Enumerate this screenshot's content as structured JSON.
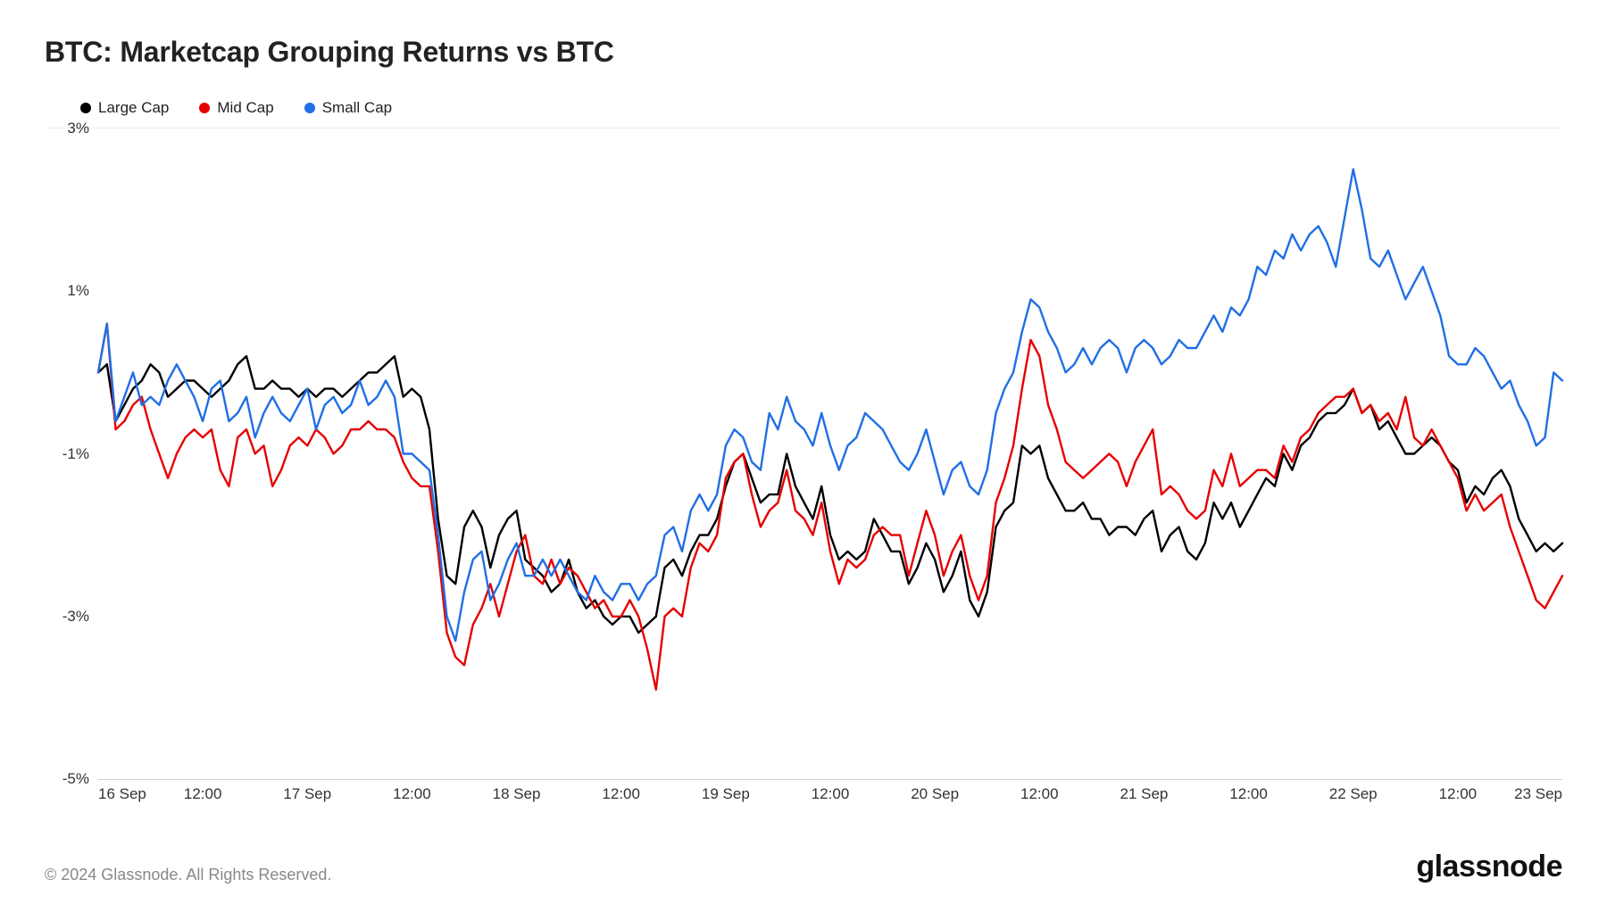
{
  "title": "BTC: Marketcap Grouping Returns vs BTC",
  "copyright": "© 2024 Glassnode. All Rights Reserved.",
  "brand": "glassnode",
  "legend": [
    {
      "label": "Large Cap",
      "color": "#000000"
    },
    {
      "label": "Mid Cap",
      "color": "#e60000"
    },
    {
      "label": "Small Cap",
      "color": "#1f6fe5"
    }
  ],
  "chart_data": {
    "type": "line",
    "ylabel": "",
    "xlabel": "",
    "ylim": [
      -5,
      3
    ],
    "y_ticks": [
      3,
      1,
      -1,
      -3,
      -5
    ],
    "y_tick_labels": [
      "3%",
      "1%",
      "-1%",
      "-3%",
      "-5%"
    ],
    "x_range": [
      0,
      168
    ],
    "x_ticks": [
      0,
      12,
      24,
      36,
      48,
      60,
      72,
      84,
      96,
      108,
      120,
      132,
      144,
      156,
      168
    ],
    "x_tick_labels": [
      "16 Sep",
      "12:00",
      "17 Sep",
      "12:00",
      "18 Sep",
      "12:00",
      "19 Sep",
      "12:00",
      "20 Sep",
      "12:00",
      "21 Sep",
      "12:00",
      "22 Sep",
      "12:00",
      "23 Sep"
    ],
    "x": [
      0,
      1,
      2,
      3,
      4,
      5,
      6,
      7,
      8,
      9,
      10,
      11,
      12,
      13,
      14,
      15,
      16,
      17,
      18,
      19,
      20,
      21,
      22,
      23,
      24,
      25,
      26,
      27,
      28,
      29,
      30,
      31,
      32,
      33,
      34,
      35,
      36,
      37,
      38,
      39,
      40,
      41,
      42,
      43,
      44,
      45,
      46,
      47,
      48,
      49,
      50,
      51,
      52,
      53,
      54,
      55,
      56,
      57,
      58,
      59,
      60,
      61,
      62,
      63,
      64,
      65,
      66,
      67,
      68,
      69,
      70,
      71,
      72,
      73,
      74,
      75,
      76,
      77,
      78,
      79,
      80,
      81,
      82,
      83,
      84,
      85,
      86,
      87,
      88,
      89,
      90,
      91,
      92,
      93,
      94,
      95,
      96,
      97,
      98,
      99,
      100,
      101,
      102,
      103,
      104,
      105,
      106,
      107,
      108,
      109,
      110,
      111,
      112,
      113,
      114,
      115,
      116,
      117,
      118,
      119,
      120,
      121,
      122,
      123,
      124,
      125,
      126,
      127,
      128,
      129,
      130,
      131,
      132,
      133,
      134,
      135,
      136,
      137,
      138,
      139,
      140,
      141,
      142,
      143,
      144,
      145,
      146,
      147,
      148,
      149,
      150,
      151,
      152,
      153,
      154,
      155,
      156,
      157,
      158,
      159,
      160,
      161,
      162,
      163,
      164,
      165,
      166,
      167,
      168
    ],
    "series": [
      {
        "name": "Large Cap",
        "color": "#000000",
        "values": [
          0.0,
          0.1,
          -0.6,
          -0.4,
          -0.2,
          -0.1,
          0.1,
          0.0,
          -0.3,
          -0.2,
          -0.1,
          -0.1,
          -0.2,
          -0.3,
          -0.2,
          -0.1,
          0.1,
          0.2,
          -0.2,
          -0.2,
          -0.1,
          -0.2,
          -0.2,
          -0.3,
          -0.2,
          -0.3,
          -0.2,
          -0.2,
          -0.3,
          -0.2,
          -0.1,
          0.0,
          0.0,
          0.1,
          0.2,
          -0.3,
          -0.2,
          -0.3,
          -0.7,
          -1.8,
          -2.5,
          -2.6,
          -1.9,
          -1.7,
          -1.9,
          -2.4,
          -2.0,
          -1.8,
          -1.7,
          -2.3,
          -2.4,
          -2.5,
          -2.7,
          -2.6,
          -2.3,
          -2.7,
          -2.9,
          -2.8,
          -3.0,
          -3.1,
          -3.0,
          -3.0,
          -3.2,
          -3.1,
          -3.0,
          -2.4,
          -2.3,
          -2.5,
          -2.2,
          -2.0,
          -2.0,
          -1.8,
          -1.4,
          -1.1,
          -1.0,
          -1.3,
          -1.6,
          -1.5,
          -1.5,
          -1.0,
          -1.4,
          -1.6,
          -1.8,
          -1.4,
          -2.0,
          -2.3,
          -2.2,
          -2.3,
          -2.2,
          -1.8,
          -2.0,
          -2.2,
          -2.2,
          -2.6,
          -2.4,
          -2.1,
          -2.3,
          -2.7,
          -2.5,
          -2.2,
          -2.8,
          -3.0,
          -2.7,
          -1.9,
          -1.7,
          -1.6,
          -0.9,
          -1.0,
          -0.9,
          -1.3,
          -1.5,
          -1.7,
          -1.7,
          -1.6,
          -1.8,
          -1.8,
          -2.0,
          -1.9,
          -1.9,
          -2.0,
          -1.8,
          -1.7,
          -2.2,
          -2.0,
          -1.9,
          -2.2,
          -2.3,
          -2.1,
          -1.6,
          -1.8,
          -1.6,
          -1.9,
          -1.7,
          -1.5,
          -1.3,
          -1.4,
          -1.0,
          -1.2,
          -0.9,
          -0.8,
          -0.6,
          -0.5,
          -0.5,
          -0.4,
          -0.2,
          -0.5,
          -0.4,
          -0.7,
          -0.6,
          -0.8,
          -1.0,
          -1.0,
          -0.9,
          -0.8,
          -0.9,
          -1.1,
          -1.2,
          -1.6,
          -1.4,
          -1.5,
          -1.3,
          -1.2,
          -1.4,
          -1.8,
          -2.0,
          -2.2,
          -2.1,
          -2.2,
          -2.1
        ]
      },
      {
        "name": "Mid Cap",
        "color": "#e60000",
        "values": [
          0.0,
          0.6,
          -0.7,
          -0.6,
          -0.4,
          -0.3,
          -0.7,
          -1.0,
          -1.3,
          -1.0,
          -0.8,
          -0.7,
          -0.8,
          -0.7,
          -1.2,
          -1.4,
          -0.8,
          -0.7,
          -1.0,
          -0.9,
          -1.4,
          -1.2,
          -0.9,
          -0.8,
          -0.9,
          -0.7,
          -0.8,
          -1.0,
          -0.9,
          -0.7,
          -0.7,
          -0.6,
          -0.7,
          -0.7,
          -0.8,
          -1.1,
          -1.3,
          -1.4,
          -1.4,
          -2.2,
          -3.2,
          -3.5,
          -3.6,
          -3.1,
          -2.9,
          -2.6,
          -3.0,
          -2.6,
          -2.2,
          -2.0,
          -2.5,
          -2.6,
          -2.3,
          -2.6,
          -2.4,
          -2.5,
          -2.7,
          -2.9,
          -2.8,
          -3.0,
          -3.0,
          -2.8,
          -3.0,
          -3.4,
          -3.9,
          -3.0,
          -2.9,
          -3.0,
          -2.4,
          -2.1,
          -2.2,
          -2.0,
          -1.3,
          -1.1,
          -1.0,
          -1.5,
          -1.9,
          -1.7,
          -1.6,
          -1.2,
          -1.7,
          -1.8,
          -2.0,
          -1.6,
          -2.2,
          -2.6,
          -2.3,
          -2.4,
          -2.3,
          -2.0,
          -1.9,
          -2.0,
          -2.0,
          -2.5,
          -2.1,
          -1.7,
          -2.0,
          -2.5,
          -2.2,
          -2.0,
          -2.5,
          -2.8,
          -2.5,
          -1.6,
          -1.3,
          -0.9,
          -0.2,
          0.4,
          0.2,
          -0.4,
          -0.7,
          -1.1,
          -1.2,
          -1.3,
          -1.2,
          -1.1,
          -1.0,
          -1.1,
          -1.4,
          -1.1,
          -0.9,
          -0.7,
          -1.5,
          -1.4,
          -1.5,
          -1.7,
          -1.8,
          -1.7,
          -1.2,
          -1.4,
          -1.0,
          -1.4,
          -1.3,
          -1.2,
          -1.2,
          -1.3,
          -0.9,
          -1.1,
          -0.8,
          -0.7,
          -0.5,
          -0.4,
          -0.3,
          -0.3,
          -0.2,
          -0.5,
          -0.4,
          -0.6,
          -0.5,
          -0.7,
          -0.3,
          -0.8,
          -0.9,
          -0.7,
          -0.9,
          -1.1,
          -1.3,
          -1.7,
          -1.5,
          -1.7,
          -1.6,
          -1.5,
          -1.9,
          -2.2,
          -2.5,
          -2.8,
          -2.9,
          -2.7,
          -2.5
        ]
      },
      {
        "name": "Small Cap",
        "color": "#1f6fe5",
        "values": [
          0.0,
          0.6,
          -0.6,
          -0.3,
          0.0,
          -0.4,
          -0.3,
          -0.4,
          -0.1,
          0.1,
          -0.1,
          -0.3,
          -0.6,
          -0.2,
          -0.1,
          -0.6,
          -0.5,
          -0.3,
          -0.8,
          -0.5,
          -0.3,
          -0.5,
          -0.6,
          -0.4,
          -0.2,
          -0.7,
          -0.4,
          -0.3,
          -0.5,
          -0.4,
          -0.1,
          -0.4,
          -0.3,
          -0.1,
          -0.3,
          -1.0,
          -1.0,
          -1.1,
          -1.2,
          -2.0,
          -3.0,
          -3.3,
          -2.7,
          -2.3,
          -2.2,
          -2.8,
          -2.6,
          -2.3,
          -2.1,
          -2.5,
          -2.5,
          -2.3,
          -2.5,
          -2.3,
          -2.5,
          -2.7,
          -2.8,
          -2.5,
          -2.7,
          -2.8,
          -2.6,
          -2.6,
          -2.8,
          -2.6,
          -2.5,
          -2.0,
          -1.9,
          -2.2,
          -1.7,
          -1.5,
          -1.7,
          -1.5,
          -0.9,
          -0.7,
          -0.8,
          -1.1,
          -1.2,
          -0.5,
          -0.7,
          -0.3,
          -0.6,
          -0.7,
          -0.9,
          -0.5,
          -0.9,
          -1.2,
          -0.9,
          -0.8,
          -0.5,
          -0.6,
          -0.7,
          -0.9,
          -1.1,
          -1.2,
          -1.0,
          -0.7,
          -1.1,
          -1.5,
          -1.2,
          -1.1,
          -1.4,
          -1.5,
          -1.2,
          -0.5,
          -0.2,
          0.0,
          0.5,
          0.9,
          0.8,
          0.5,
          0.3,
          0.0,
          0.1,
          0.3,
          0.1,
          0.3,
          0.4,
          0.3,
          0.0,
          0.3,
          0.4,
          0.3,
          0.1,
          0.2,
          0.4,
          0.3,
          0.3,
          0.5,
          0.7,
          0.5,
          0.8,
          0.7,
          0.9,
          1.3,
          1.2,
          1.5,
          1.4,
          1.7,
          1.5,
          1.7,
          1.8,
          1.6,
          1.3,
          1.9,
          2.5,
          2.0,
          1.4,
          1.3,
          1.5,
          1.2,
          0.9,
          1.1,
          1.3,
          1.0,
          0.7,
          0.2,
          0.1,
          0.1,
          0.3,
          0.2,
          0.0,
          -0.2,
          -0.1,
          -0.4,
          -0.6,
          -0.9,
          -0.8,
          0.0,
          -0.1
        ]
      }
    ]
  }
}
